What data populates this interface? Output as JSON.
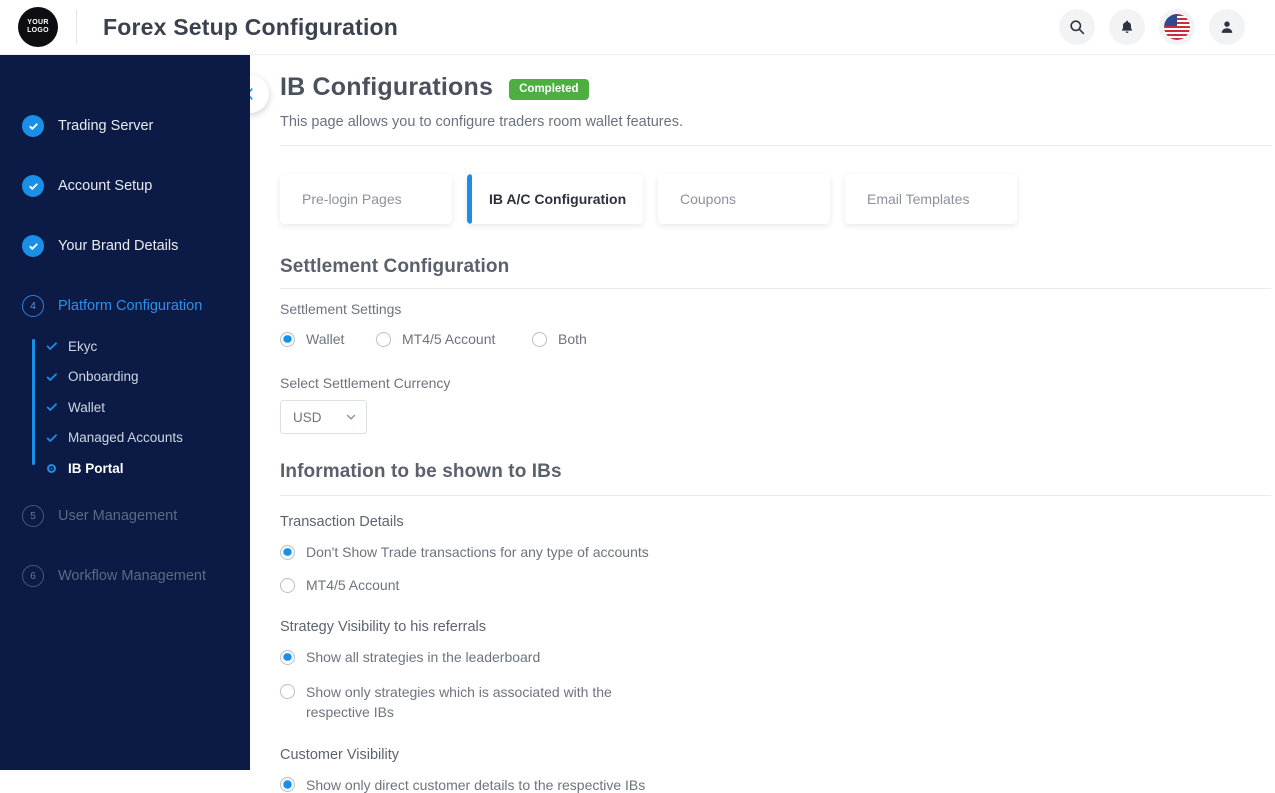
{
  "header": {
    "logo_line1": "YOUR",
    "logo_line2": "LOGO",
    "title": "Forex Setup Configuration",
    "actions": [
      {
        "name": "search-icon",
        "label": "Search"
      },
      {
        "name": "bell-icon",
        "label": "Notifications"
      },
      {
        "name": "flag-icon",
        "label": "Language"
      },
      {
        "name": "user-icon",
        "label": "Profile"
      }
    ]
  },
  "sidebar": {
    "items": [
      {
        "label": "Trading Server",
        "state": "done",
        "step": "1"
      },
      {
        "label": "Account Setup",
        "state": "done",
        "step": "2"
      },
      {
        "label": "Your Brand Details",
        "state": "done",
        "step": "3"
      },
      {
        "label": "Platform Configuration",
        "state": "current",
        "step": "4"
      },
      {
        "label": "User Management",
        "state": "pending",
        "step": "5"
      },
      {
        "label": "Workflow Management",
        "state": "pending",
        "step": "6"
      }
    ],
    "subitems": [
      {
        "label": "Ekyc",
        "state": "done"
      },
      {
        "label": "Onboarding",
        "state": "done"
      },
      {
        "label": "Wallet",
        "state": "done"
      },
      {
        "label": "Managed Accounts",
        "state": "done"
      },
      {
        "label": "IB Portal",
        "state": "active"
      }
    ]
  },
  "page": {
    "title": "IB Configurations",
    "badge": "Completed",
    "subtitle": "This page allows you to configure traders room wallet features."
  },
  "tabs": [
    {
      "label": "Pre-login Pages",
      "active": false
    },
    {
      "label": "IB A/C Configuration",
      "active": true
    },
    {
      "label": "Coupons",
      "active": false
    },
    {
      "label": "Email Templates",
      "active": false
    }
  ],
  "settlement": {
    "section_title": "Settlement Configuration",
    "settings_label": "Settlement Settings",
    "options": [
      {
        "label": "Wallet",
        "checked": true
      },
      {
        "label": "MT4/5 Account",
        "checked": false
      },
      {
        "label": "Both",
        "checked": false
      }
    ],
    "currency_label": "Select Settlement Currency",
    "currency_value": "USD"
  },
  "info": {
    "section_title": "Information to be shown to IBs",
    "groups": [
      {
        "label": "Transaction Details",
        "options": [
          {
            "label": "Don't Show Trade transactions for any type of accounts",
            "checked": true
          },
          {
            "label": "MT4/5 Account",
            "checked": false
          }
        ]
      },
      {
        "label": "Strategy Visibility to his referrals",
        "options": [
          {
            "label": "Show all strategies in the leaderboard",
            "checked": true
          },
          {
            "label": "Show only strategies which is associated with the respective IBs",
            "checked": false
          }
        ]
      },
      {
        "label": "Customer Visibility",
        "options": [
          {
            "label": "Show only direct customer details to the respective IBs",
            "checked": true
          }
        ]
      }
    ]
  },
  "colors": {
    "sidebar_bg": "#0b1b45",
    "accent_blue": "#1a8fe8",
    "badge_green": "#4caf3f"
  }
}
